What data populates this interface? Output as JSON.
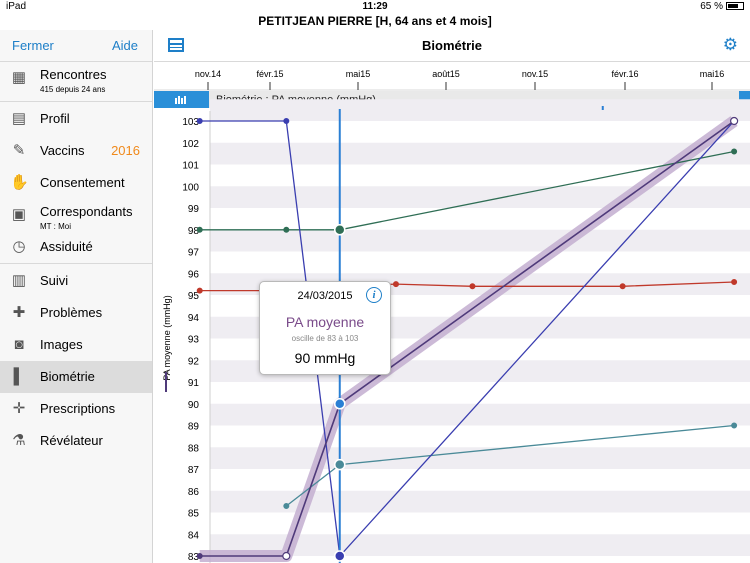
{
  "status": {
    "device": "iPad",
    "time": "11:29",
    "battery": "65 %"
  },
  "patient": "PETITJEAN PIERRE [H, 64 ans et 4 mois]",
  "sidebar": {
    "close_label": "Fermer",
    "help_label": "Aide",
    "items": [
      {
        "label": "Rencontres",
        "sub": "415 depuis 24 ans",
        "icon": "encounters-icon"
      },
      {
        "label": "Profil",
        "icon": "profile-icon"
      },
      {
        "label": "Vaccins",
        "badge": "2016",
        "icon": "syringe-icon"
      },
      {
        "label": "Consentement",
        "icon": "handshake-icon"
      },
      {
        "label": "Correspondants",
        "sub": "MT : Moi",
        "icon": "contacts-icon"
      },
      {
        "label": "Assiduité",
        "icon": "clock-icon"
      },
      {
        "label": "Suivi",
        "icon": "book-icon"
      },
      {
        "label": "Problèmes",
        "icon": "puzzle-icon"
      },
      {
        "label": "Images",
        "icon": "camera-icon"
      },
      {
        "label": "Biométrie",
        "icon": "bar-chart-icon",
        "selected": true
      },
      {
        "label": "Prescriptions",
        "icon": "cross-icon"
      },
      {
        "label": "Révélateur",
        "icon": "flask-icon"
      }
    ]
  },
  "header": {
    "title": "Biométrie"
  },
  "chart_data": {
    "type": "line",
    "title": "Biométrie : PA moyenne  (mmHg)",
    "ylabel": "PA moyenne  (mmHg)",
    "x_ticks": [
      "nov.14",
      "févr.15",
      "mai15",
      "août15",
      "nov.15",
      "févr.16",
      "mai16"
    ],
    "y_ticks": [
      83,
      84,
      85,
      86,
      87,
      88,
      89,
      90,
      91,
      92,
      93,
      94,
      95,
      96,
      97,
      98,
      99,
      100,
      101,
      102,
      103
    ],
    "ylim": [
      83,
      103
    ],
    "grid": "horizontal bands",
    "colors": {
      "main": "#4f3a7a",
      "highlight": "#c3aed0",
      "blue": "#3a3eb0",
      "green": "#2f6e55",
      "red": "#c0392b",
      "teal": "#4a8a98",
      "cursor": "#2a7fd4"
    },
    "series": [
      {
        "name": "PA moyenne",
        "points": [
          [
            "2014-10-23",
            83
          ],
          [
            "2015-01-25",
            83
          ],
          [
            "2015-03-24",
            90
          ],
          [
            "2016-05-25",
            103
          ]
        ]
      },
      {
        "points": [
          [
            "2014-10-23",
            103
          ],
          [
            "2015-01-25",
            103
          ],
          [
            "2015-03-24",
            83
          ],
          [
            "2016-05-25",
            103
          ]
        ]
      },
      {
        "points": [
          [
            "2014-10-23",
            98
          ],
          [
            "2015-01-25",
            98
          ],
          [
            "2015-03-24",
            98
          ],
          [
            "2016-05-25",
            101.6
          ]
        ]
      },
      {
        "points": [
          [
            "2014-10-23",
            95.2
          ],
          [
            "2015-01-25",
            95.2
          ],
          [
            "2015-03-24",
            95.4
          ],
          [
            "2015-05-24",
            95.5
          ],
          [
            "2015-08-15",
            95.4
          ],
          [
            "2016-01-25",
            95.4
          ],
          [
            "2016-05-25",
            95.6
          ]
        ]
      },
      {
        "points": [
          [
            "2015-01-25",
            85.3
          ],
          [
            "2015-03-24",
            87.2
          ],
          [
            "2016-05-25",
            89
          ]
        ]
      }
    ],
    "cursor_date": "2015-03-24"
  },
  "tooltip": {
    "date": "24/03/2015",
    "name": "PA moyenne",
    "range": "oscille de 83 à 103",
    "value": "90 mmHg"
  }
}
